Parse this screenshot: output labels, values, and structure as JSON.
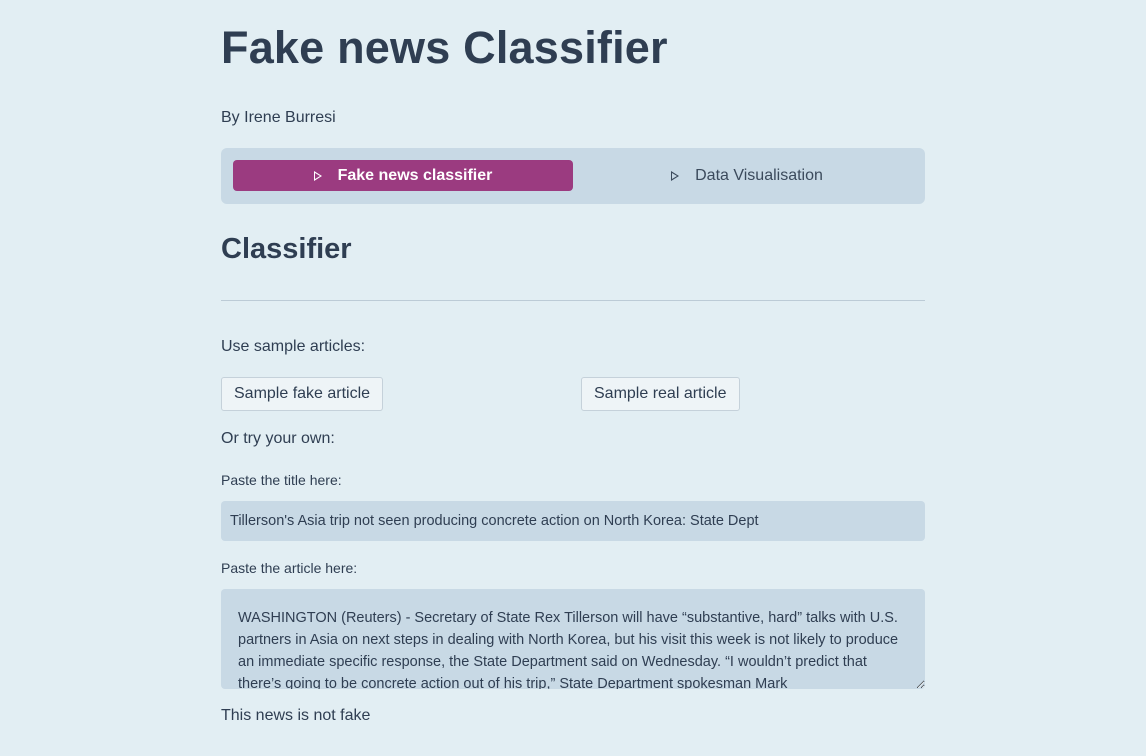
{
  "header": {
    "title": "Fake news Classifier",
    "author": "By Irene Burresi"
  },
  "tabs": [
    {
      "label": "Fake news classifier",
      "active": true,
      "icon": "play-outline-icon"
    },
    {
      "label": "Data Visualisation",
      "active": false,
      "icon": "play-outline-icon"
    }
  ],
  "classifier": {
    "heading": "Classifier",
    "sample_label": "Use sample articles:",
    "sample_fake_button": "Sample fake article",
    "sample_real_button": "Sample real article",
    "own_label": "Or try your own:",
    "title_label": "Paste the title here:",
    "title_value": "Tillerson's Asia trip not seen producing concrete action on North Korea: State Dept",
    "article_label": "Paste the article here:",
    "article_value": "WASHINGTON (Reuters) - Secretary of State Rex Tillerson will have “substantive, hard” talks with U.S. partners in Asia on next steps in dealing with North Korea, but his visit this week is not likely to produce an immediate specific response, the State Department said on Wednesday. “I wouldn’t predict that there’s going to be concrete action out of his trip,” State Department spokesman Mark",
    "result": "This news is not fake"
  },
  "colors": {
    "background": "#e2eef3",
    "accent": "#9b3b80",
    "panel": "#c8d9e5",
    "text": "#2f3e52"
  }
}
